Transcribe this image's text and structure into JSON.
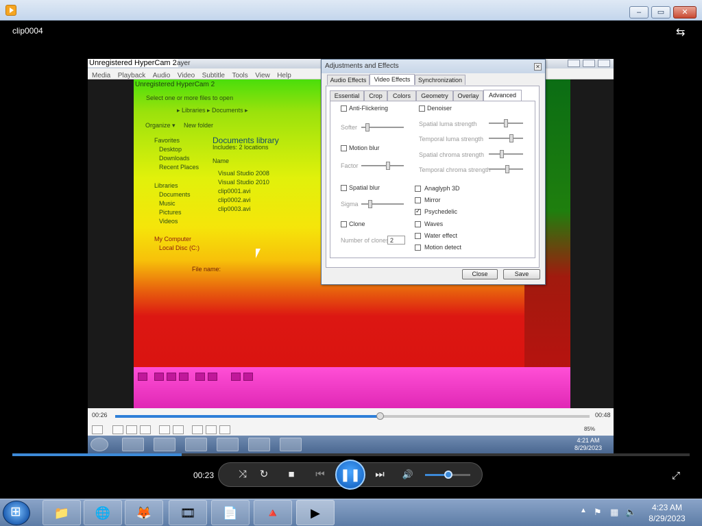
{
  "window": {
    "title_icon": "vlc-player-icon",
    "clip_title": "clip0004",
    "min_glyph": "–",
    "max_glyph": "▭",
    "close_glyph": "✕",
    "layout_glyph": "⇆"
  },
  "recording": {
    "hypercam_label": "Unregistered HyperCam 2",
    "inner_title_suffix": "ayer",
    "menu": [
      "Media",
      "Playback",
      "Audio",
      "Video",
      "Subtitle",
      "Tools",
      "View",
      "Help"
    ],
    "inner_hypercam_label": "Unregistered HyperCam 2",
    "open_dialog_title": "Select one or more files to open",
    "breadcrumb": "▸ Libraries ▸ Documents ▸",
    "organize": "Organize ▾",
    "new_folder": "New folder",
    "nav": [
      "Favorites",
      "Desktop",
      "Downloads",
      "Recent Places",
      "Libraries",
      "Documents",
      "Music",
      "Pictures",
      "Videos",
      "My Computer",
      "Local Disc (C:)"
    ],
    "library_title": "Documents library",
    "library_sub": "Includes: 2 locations",
    "column_name": "Name",
    "files": [
      "Visual Studio 2008",
      "Visual Studio 2010",
      "clip0001.avi",
      "clip0002.avi",
      "clip0003.avi"
    ],
    "file_name_label": "File name:",
    "seek_start": "00:26",
    "seek_end": "00:48",
    "vol_label": "85%",
    "inner_clock_time": "4:21 AM",
    "inner_clock_date": "8/29/2023"
  },
  "dialog": {
    "title": "Adjustments and Effects",
    "close_glyph": "✕",
    "main_tabs": [
      "Audio Effects",
      "Video Effects",
      "Synchronization"
    ],
    "sub_tabs": [
      "Essential",
      "Crop",
      "Colors",
      "Geometry",
      "Overlay",
      "Advanced"
    ],
    "left": {
      "anti_flickering": "Anti-Flickering",
      "softer": "Softer",
      "motion_blur": "Motion blur",
      "factor": "Factor",
      "spatial_blur": "Spatial blur",
      "sigma": "Sigma",
      "clone": "Clone",
      "number_of_clones": "Number of clones",
      "clones_value": "2"
    },
    "right": {
      "denoiser": "Denoiser",
      "spatial_luma": "Spatial luma strength",
      "temporal_luma": "Temporal luma strength",
      "spatial_chroma": "Spatial chroma strength",
      "temporal_chroma": "Temporal chroma strength",
      "anaglyph": "Anaglyph 3D",
      "mirror": "Mirror",
      "psychedelic": "Psychedelic",
      "waves": "Waves",
      "water": "Water effect",
      "motion_detect": "Motion detect"
    },
    "close_btn": "Close",
    "save_btn": "Save"
  },
  "controls": {
    "time": "00:23",
    "random": "⤨",
    "loop": "↻",
    "stop": "■",
    "prev": "⏮",
    "pause": "❚❚",
    "next": "⏭",
    "volume": "🔊",
    "fullscreen": "⤢",
    "progress": 0.25,
    "volume_level": 0.52
  },
  "taskbar": {
    "items": [
      "📁",
      "🌐",
      "🦊",
      "🎞",
      "📄",
      "🔺",
      "▶"
    ],
    "tray_expand": "▲",
    "clock_time": "4:23 AM",
    "clock_date": "8/29/2023"
  },
  "colors": {
    "accent": "#3d8ad8",
    "psychedelic_green": "#4ade0b",
    "psychedelic_red": "#d8110f",
    "psychedelic_pink": "#ff4fd6"
  }
}
